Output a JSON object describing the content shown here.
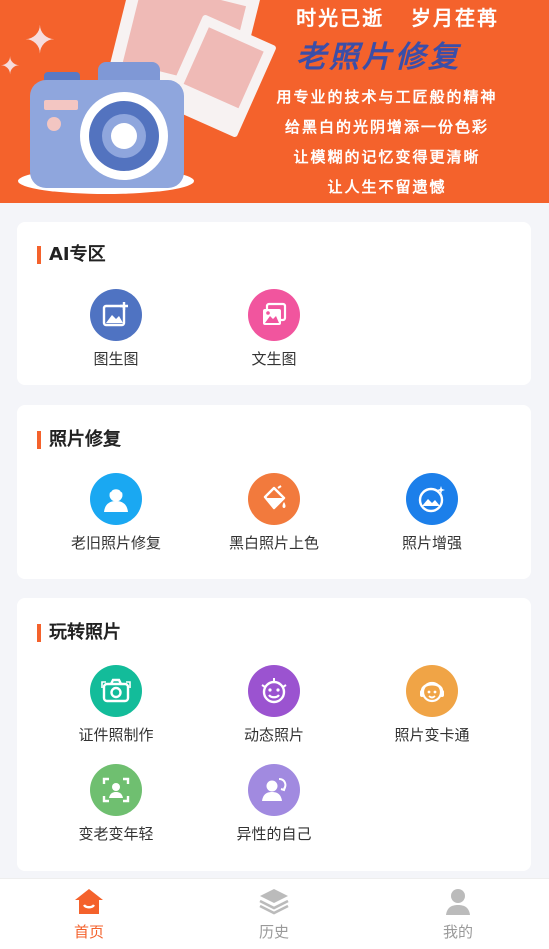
{
  "banner": {
    "title_line1": "时光已逝   岁月荏苒",
    "title_line2": "老照片修复",
    "slogans": [
      "用专业的技术与工匠般的精神",
      "给黑白的光阴增添一份色彩",
      "让模糊的记忆变得更清晰",
      "让人生不留遗憾"
    ]
  },
  "sections": [
    {
      "title": "AI专区",
      "items": [
        {
          "label": "图生图",
          "icon": "image-plus-icon",
          "color": "#4f73c2"
        },
        {
          "label": "文生图",
          "icon": "photo-gallery-icon",
          "color": "#f1559e"
        }
      ]
    },
    {
      "title": "照片修复",
      "items": [
        {
          "label": "老旧照片修复",
          "icon": "portrait-icon",
          "color": "#1aa8f2"
        },
        {
          "label": "黑白照片上色",
          "icon": "paint-bucket-icon",
          "color": "#f27a3d"
        },
        {
          "label": "照片增强",
          "icon": "magic-photo-icon",
          "color": "#1c7fea"
        }
      ]
    },
    {
      "title": "玩转照片",
      "items": [
        {
          "label": "证件照制作",
          "icon": "camera-icon",
          "color": "#13bc9a"
        },
        {
          "label": "动态照片",
          "icon": "smiley-face-icon",
          "color": "#9b53d0"
        },
        {
          "label": "照片变卡通",
          "icon": "cartoon-face-icon",
          "color": "#f0a446"
        },
        {
          "label": "变老变年轻",
          "icon": "face-scan-icon",
          "color": "#6fbf70"
        },
        {
          "label": "异性的自己",
          "icon": "user-swap-icon",
          "color": "#a18ae0"
        }
      ]
    }
  ],
  "tabbar": {
    "active_color": "#f4622c",
    "inactive_color": "#9a9a9a",
    "tabs": [
      {
        "label": "首页",
        "icon": "home-icon",
        "active": true
      },
      {
        "label": "历史",
        "icon": "layers-icon",
        "active": false
      },
      {
        "label": "我的",
        "icon": "user-icon",
        "active": false
      }
    ]
  }
}
